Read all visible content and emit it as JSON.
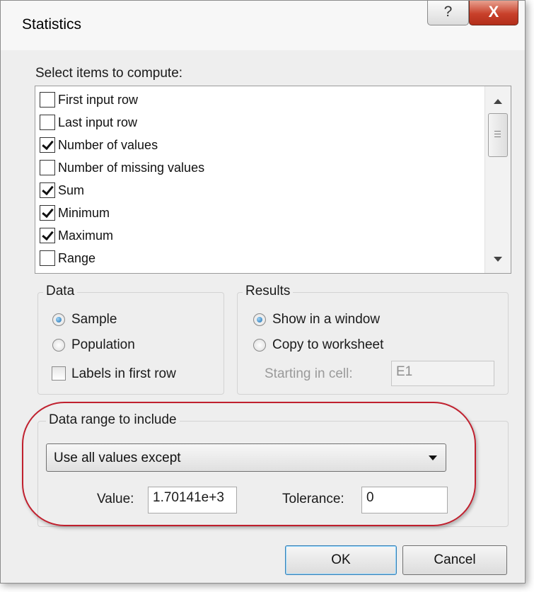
{
  "window": {
    "title": "Statistics",
    "help_glyph": "?",
    "close_glyph": "X"
  },
  "select_items": {
    "label": "Select items to compute:",
    "items": [
      {
        "label": "First input row",
        "checked": false
      },
      {
        "label": "Last input row",
        "checked": false
      },
      {
        "label": "Number of values",
        "checked": true
      },
      {
        "label": "Number of missing values",
        "checked": false
      },
      {
        "label": "Sum",
        "checked": true
      },
      {
        "label": "Minimum",
        "checked": true
      },
      {
        "label": "Maximum",
        "checked": true
      },
      {
        "label": "Range",
        "checked": false
      }
    ]
  },
  "data_group": {
    "title": "Data",
    "sample_label": "Sample",
    "sample_selected": true,
    "population_label": "Population",
    "population_selected": false,
    "labels_first_row_label": "Labels in first row",
    "labels_first_row_checked": false
  },
  "results_group": {
    "title": "Results",
    "show_window_label": "Show in a window",
    "show_window_selected": true,
    "copy_worksheet_label": "Copy to worksheet",
    "copy_worksheet_selected": false,
    "starting_cell_label": "Starting in cell:",
    "starting_cell_value": "E1"
  },
  "range_group": {
    "title": "Data range to include",
    "selected_option": "Use all values except",
    "value_label": "Value:",
    "value": "1.70141e+3",
    "tolerance_label": "Tolerance:",
    "tolerance": "0"
  },
  "buttons": {
    "ok": "OK",
    "cancel": "Cancel"
  },
  "colors": {
    "highlight": "#c0202e",
    "close_button": "#c8402a",
    "radio_accent": "#1f6fb0"
  }
}
